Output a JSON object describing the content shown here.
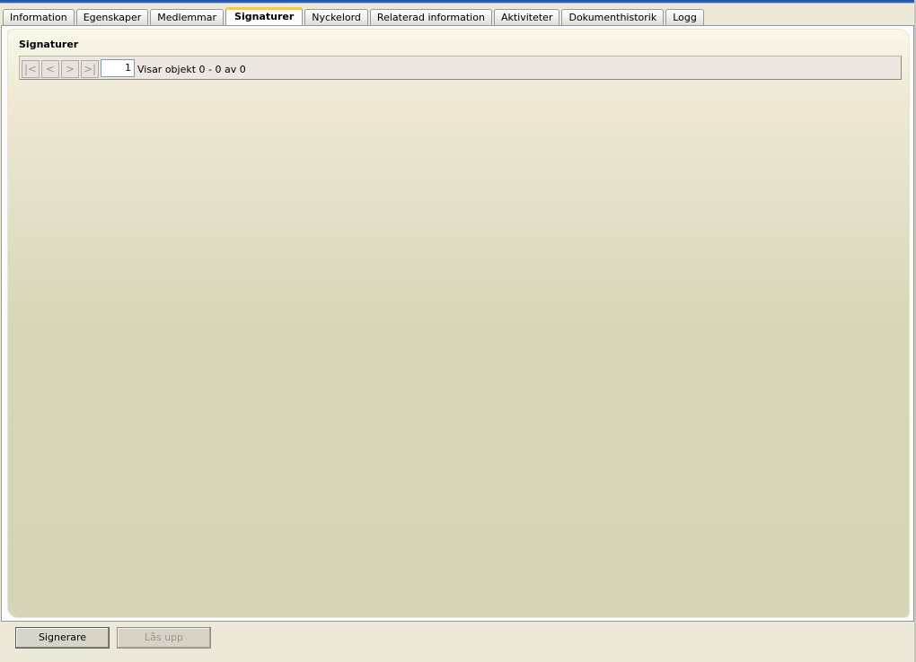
{
  "tabs": [
    {
      "label": "Information"
    },
    {
      "label": "Egenskaper"
    },
    {
      "label": "Medlemmar"
    },
    {
      "label": "Signaturer"
    },
    {
      "label": "Nyckelord"
    },
    {
      "label": "Relaterad information"
    },
    {
      "label": "Aktiviteter"
    },
    {
      "label": "Dokumenthistorik"
    },
    {
      "label": "Logg"
    }
  ],
  "active_tab": "Signaturer",
  "panel": {
    "title": "Signaturer"
  },
  "pager": {
    "first_label": "|<",
    "prev_label": "<",
    "next_label": ">",
    "last_label": ">|",
    "page_value": "1",
    "status": "Visar objekt 0 - 0 av 0"
  },
  "actions": {
    "sign_label": "Signerare",
    "unlock_label": "Lås upp"
  },
  "colors": {
    "active_tab_accent": "#ffc83c",
    "panel_top": "#fbf8ea",
    "panel_bottom": "#d6d4b6"
  }
}
